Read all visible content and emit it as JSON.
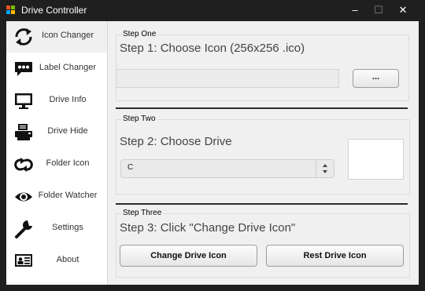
{
  "window": {
    "title": "Drive Controller",
    "minimize": "–",
    "maximize": "☐",
    "close": "✕"
  },
  "sidebar": {
    "items": [
      {
        "label": "Icon Changer",
        "icon": "refresh-icon",
        "active": true
      },
      {
        "label": "Label Changer",
        "icon": "speech-bubble-icon"
      },
      {
        "label": "Drive Info",
        "icon": "monitor-icon"
      },
      {
        "label": "Drive Hide",
        "icon": "printer-icon"
      },
      {
        "label": "Folder Icon",
        "icon": "loop-arrows-icon"
      },
      {
        "label": "Folder Watcher",
        "icon": "eye-icon"
      },
      {
        "label": "Settings",
        "icon": "wrench-icon"
      },
      {
        "label": "About",
        "icon": "id-card-icon"
      }
    ]
  },
  "step_one": {
    "legend": "Step One",
    "title": "Step 1: Choose Icon (256x256 .ico)",
    "path_value": "",
    "browse_label": "..."
  },
  "step_two": {
    "legend": "Step Two",
    "title": "Step 2: Choose Drive",
    "drive_selected": "C"
  },
  "step_three": {
    "legend": "Step Three",
    "title": "Step 3: Click \"Change Drive Icon\"",
    "change_label": "Change Drive Icon",
    "reset_label": "Rest Drive Icon"
  },
  "colors": {
    "titlebar": "#1f1f1f",
    "sidebar": "#ffffff",
    "panel": "#f0f0f0",
    "app_icon": [
      "#f25022",
      "#7fba00",
      "#00a4ef",
      "#ffb900"
    ]
  }
}
